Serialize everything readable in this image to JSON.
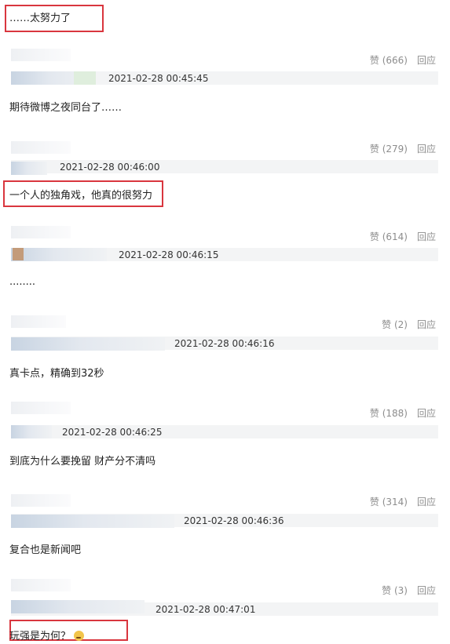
{
  "top_comment": "……太努力了",
  "comments": [
    {
      "likes": "赞 (666)",
      "reply": "回应",
      "time": "2021-02-28 00:45:45",
      "text": "期待微博之夜同台了……"
    },
    {
      "likes": "赞 (279)",
      "reply": "回应",
      "time": "2021-02-28 00:46:00",
      "text": "一个人的独角戏，他真的很努力"
    },
    {
      "likes": "赞 (614)",
      "reply": "回应",
      "time": "2021-02-28 00:46:15",
      "text": "........"
    },
    {
      "likes": "赞 (2)",
      "reply": "回应",
      "time": "2021-02-28 00:46:16",
      "text": "真卡点，精确到32秒"
    },
    {
      "likes": "赞 (188)",
      "reply": "回应",
      "time": "2021-02-28 00:46:25",
      "text": "到底为什么要挽留 财产分不清吗"
    },
    {
      "likes": "赞 (314)",
      "reply": "回应",
      "time": "2021-02-28 00:46:36",
      "text": "复合也是新闻吧"
    },
    {
      "likes": "赞 (3)",
      "reply": "回应",
      "time": "2021-02-28 00:47:01",
      "text": "玩强是为何？"
    }
  ],
  "colors": {
    "highlight_box": "#d9363e",
    "meta_gray": "#8d8d8d"
  },
  "icons": {
    "last_comment_emoji": "worried-face-icon"
  }
}
